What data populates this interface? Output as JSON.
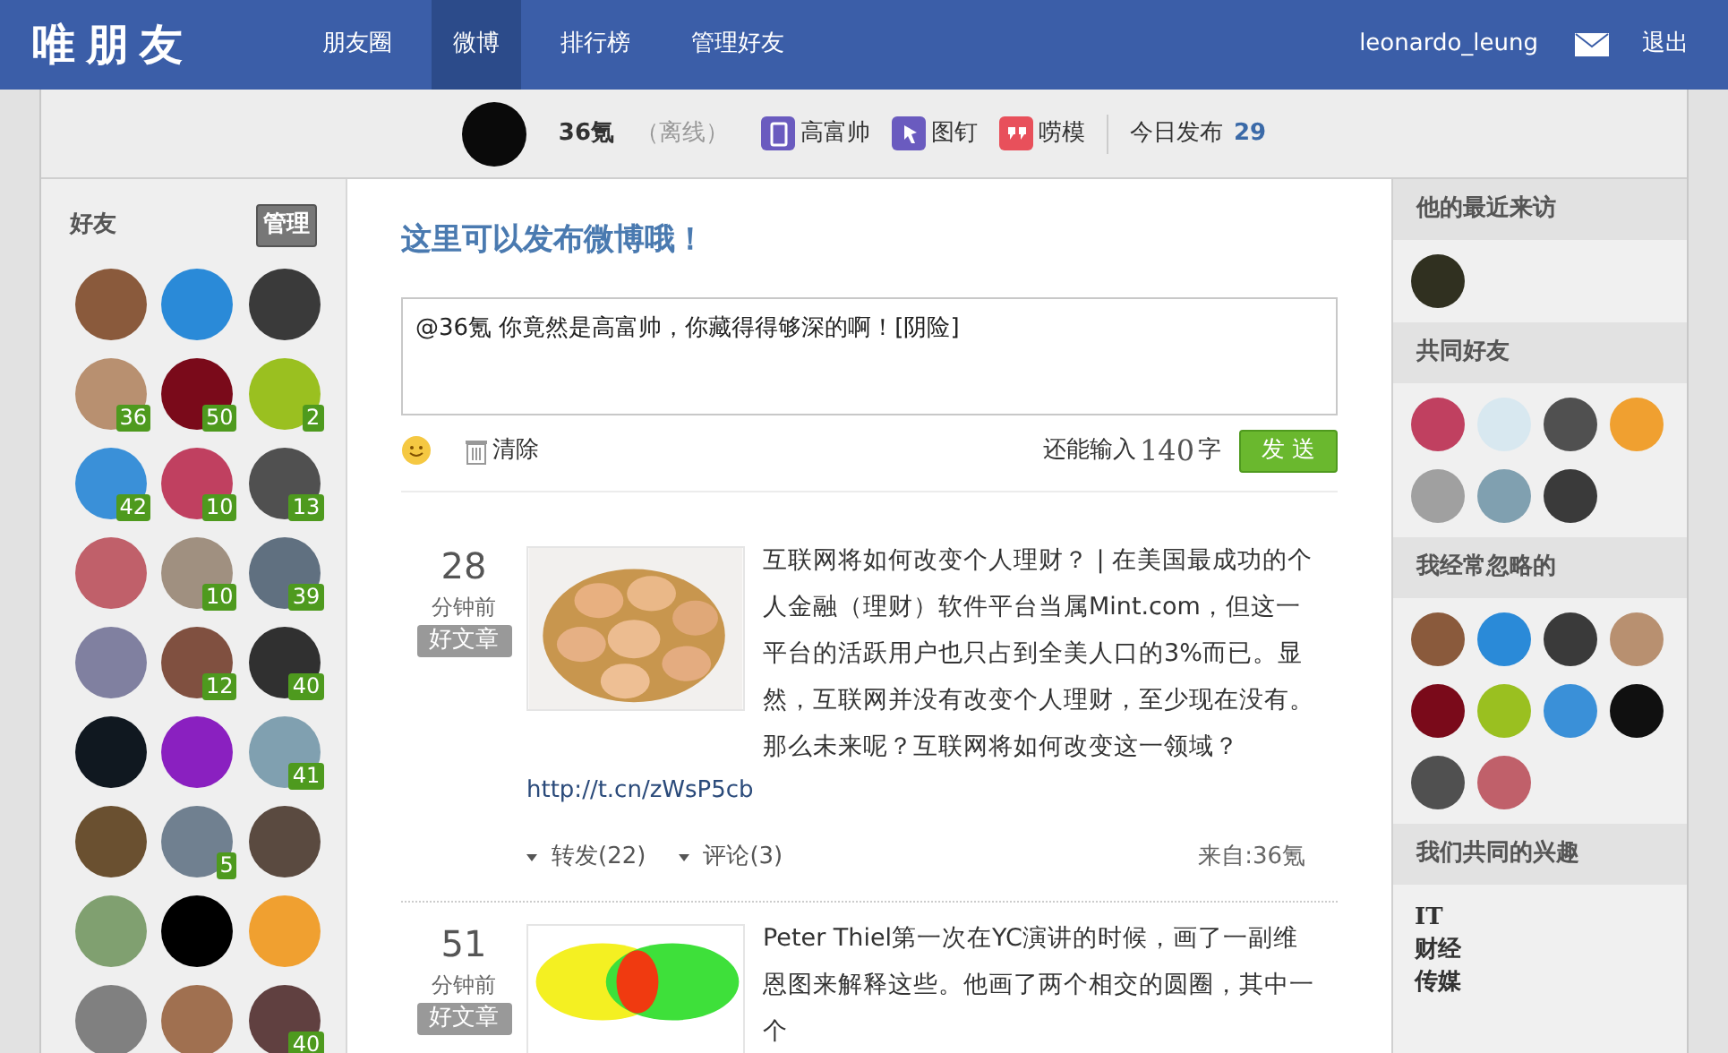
{
  "header": {
    "logo": "唯朋友",
    "nav": [
      {
        "label": "朋友圈",
        "selected": false
      },
      {
        "label": "微博",
        "selected": true
      },
      {
        "label": "排行榜",
        "selected": false
      },
      {
        "label": "管理好友",
        "selected": false
      }
    ],
    "username": "leonardo_leung",
    "logout": "退出"
  },
  "profile_bar": {
    "name": "36氪",
    "status": "（离线）",
    "badges": [
      {
        "label": "高富帅",
        "color": "#6a5bbf",
        "kind": "phone"
      },
      {
        "label": "图钉",
        "color": "#6a5bbf",
        "kind": "pin"
      },
      {
        "label": "唠模",
        "color": "#e8505b",
        "kind": "chat"
      }
    ],
    "today_label": "今日发布",
    "today_count": "29"
  },
  "friends": {
    "title": "好友",
    "manage": "管理",
    "items": [
      {
        "color": "#8a5a3c"
      },
      {
        "color": "#2a8ad8"
      },
      {
        "color": "#3a3a3a"
      },
      {
        "color": "#b89070",
        "badge": "36"
      },
      {
        "color": "#7a0a1a",
        "badge": "50"
      },
      {
        "color": "#9ac020",
        "badge": "2"
      },
      {
        "color": "#3a90d8",
        "badge": "42"
      },
      {
        "color": "#c04060",
        "badge": "10"
      },
      {
        "color": "#505050",
        "badge": "13"
      },
      {
        "color": "#c0606a"
      },
      {
        "color": "#a09080",
        "badge": "10"
      },
      {
        "color": "#607080",
        "badge": "39"
      },
      {
        "color": "#8080a0"
      },
      {
        "color": "#805040",
        "badge": "12"
      },
      {
        "color": "#303030",
        "badge": "40"
      },
      {
        "color": "#101820"
      },
      {
        "color": "#8a20c0"
      },
      {
        "color": "#80a0b0",
        "badge": "41"
      },
      {
        "color": "#6a5030"
      },
      {
        "color": "#708090",
        "badge": "5"
      },
      {
        "color": "#5a4a40"
      },
      {
        "color": "#80a070"
      },
      {
        "color": "#000000"
      },
      {
        "color": "#f0a030"
      },
      {
        "color": "#808080"
      },
      {
        "color": "#a07050"
      },
      {
        "color": "#604040",
        "badge": "40"
      }
    ]
  },
  "composer": {
    "title": "这里可以发布微博哦！",
    "value": "@36氪 你竟然是高富帅，你藏得得够深的啊！[阴险]",
    "clear": "清除",
    "remaining_prefix": "还能输入",
    "remaining": "140",
    "remaining_suffix": "字",
    "send": "发 送"
  },
  "posts": [
    {
      "time": "28",
      "time_unit": "分钟前",
      "tag": "好文章",
      "kind": "eggs",
      "text": "互联网将如何改变个人理财？ | 在美国最成功的个人金融（理财）软件平台当属Mint.com，但这一平台的活跃用户也只占到全美人口的3%而已。显然，互联网并没有改变个人理财，至少现在没有。那么未来呢？互联网将如何改变这一领域？",
      "link": "http://t.cn/zWsP5cb",
      "forward": "转发(22)",
      "comment": "评论(3)",
      "source": "来自:36氪"
    },
    {
      "time": "51",
      "time_unit": "分钟前",
      "tag": "好文章",
      "kind": "venn",
      "text": "Peter Thiel第一次在YC演讲的时候，画了一副维恩图来解释这些。他画了两个相交的圆圈，其中一个"
    }
  ],
  "sidebar": [
    {
      "title": "他的最近来访",
      "kind": "avatars",
      "avatars": [
        {
          "color": "#303020"
        }
      ]
    },
    {
      "title": "共同好友",
      "kind": "avatars",
      "avatars": [
        {
          "color": "#c04060"
        },
        {
          "color": "#d8e8f0"
        },
        {
          "color": "#505050"
        },
        {
          "color": "#f0a030"
        },
        {
          "color": "#a0a0a0"
        },
        {
          "color": "#80a0b0"
        },
        {
          "color": "#3a3a3a"
        }
      ]
    },
    {
      "title": "我经常忽略的",
      "kind": "avatars",
      "avatars": [
        {
          "color": "#8a5a3c"
        },
        {
          "color": "#2a8ad8"
        },
        {
          "color": "#3a3a3a"
        },
        {
          "color": "#b89070"
        },
        {
          "color": "#7a0a1a"
        },
        {
          "color": "#9ac020"
        },
        {
          "color": "#3a90d8"
        },
        {
          "color": "#101010"
        },
        {
          "color": "#505050"
        },
        {
          "color": "#c0606a"
        }
      ]
    },
    {
      "title": "我们共同的兴趣",
      "kind": "tags",
      "tags": [
        "IT",
        "财经",
        "传媒"
      ]
    }
  ]
}
